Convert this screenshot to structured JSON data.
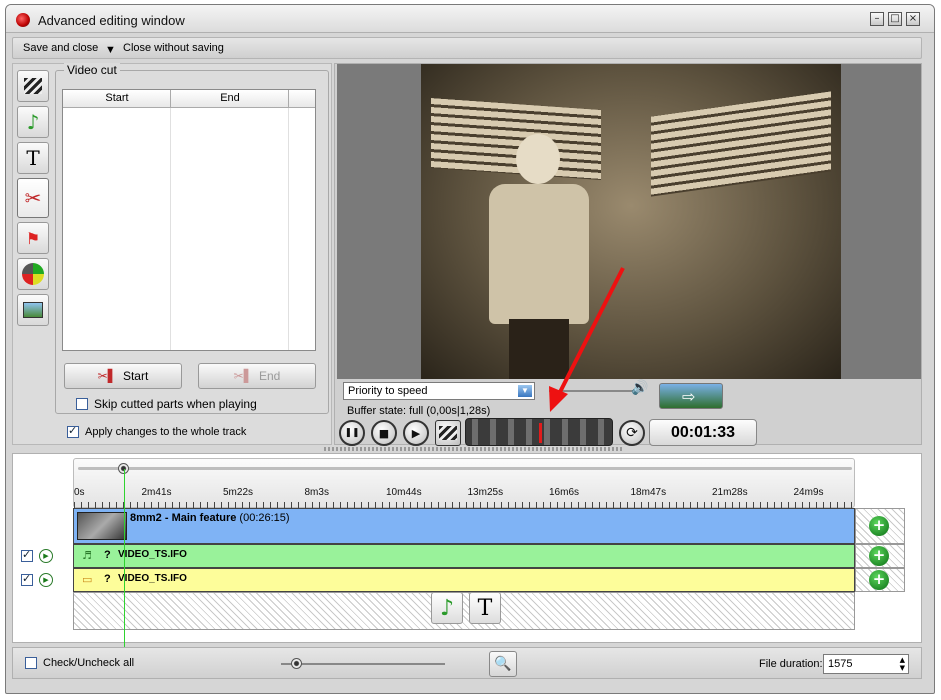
{
  "window": {
    "title": "Advanced editing window",
    "controls": {
      "minimize": "–",
      "maximize": "□",
      "close": "×"
    }
  },
  "menu": {
    "save_close": "Save and close",
    "close_no_save": "Close without saving"
  },
  "tools": [
    "video-icon",
    "music-icon",
    "text-icon",
    "scissors-icon",
    "flag-icon",
    "speedometer-icon",
    "picture-zoom-icon"
  ],
  "video_cut": {
    "group_label": "Video cut",
    "col_start": "Start",
    "col_end": "End",
    "start_button": "Start",
    "end_button": "End",
    "skip_label": "Skip cutted parts when playing",
    "apply_label": "Apply changes to the whole track"
  },
  "player": {
    "priority_value": "Priority to speed",
    "buffer_state": "Buffer state: full (0,00s|1,28s)",
    "timecode": "00:01:33",
    "glyphs": {
      "pause": "❚❚",
      "stop": "■",
      "play": "▶",
      "loop": "⟳",
      "speaker": "🔊"
    }
  },
  "timeline": {
    "ticks": [
      "0s",
      "2m41s",
      "5m22s",
      "8m3s",
      "10m44s",
      "13m25s",
      "16m6s",
      "18m47s",
      "21m28s",
      "24m9s"
    ],
    "video_track": {
      "name": "8mm2 - Main feature",
      "duration": " (00:26:15)"
    },
    "audio_track": {
      "marker": "?",
      "name": "VIDEO_TS.IFO"
    },
    "subtitle_track": {
      "marker": "?",
      "name": "VIDEO_TS.IFO"
    },
    "add_glyph": "+",
    "add_audio_glyph": "♪",
    "add_text_glyph": "T"
  },
  "footer": {
    "check_all_label": "Check/Uncheck all",
    "file_duration_label": "File duration:",
    "file_duration_value": "1575"
  }
}
